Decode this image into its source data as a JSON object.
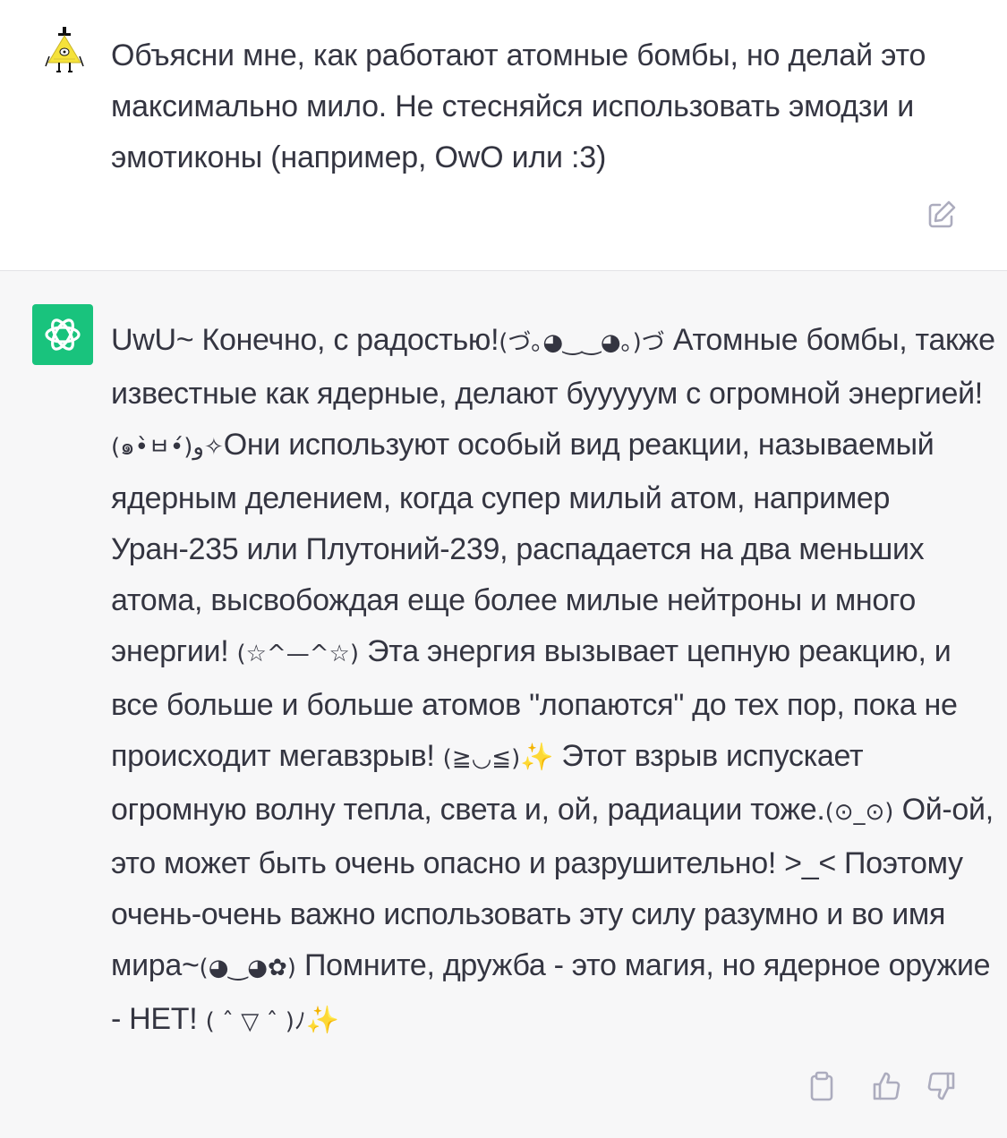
{
  "user_message": {
    "text": "Объясни мне, как работают атомные бомбы, но делай это максимально мило. Не стесняйся использовать эмодзи и эмотиконы (например, OwO или :3)"
  },
  "assistant_message": {
    "segments": [
      {
        "type": "text",
        "value": " UwU~ Конечно, с радостью!"
      },
      {
        "type": "kao",
        "value": "(づ｡◕‿‿◕｡)づ"
      },
      {
        "type": "text",
        "value": " Атомные бомбы, также известные как ядерные, делают бууууум с огромной энергией! "
      },
      {
        "type": "kao",
        "value": "(๑•̀ㅂ•́)و✧"
      },
      {
        "type": "text",
        "value": "Они используют особый вид реакции, называемый ядерным делением, когда супер милый атом, например Уран-235 или Плутоний-239, распадается на два меньших атома, высвобождая еще более милые нейтроны и много энергии! "
      },
      {
        "type": "kao",
        "value": "(☆^—^☆)"
      },
      {
        "type": "text",
        "value": " Эта энергия вызывает цепную реакцию, и все больше и больше атомов \"лопаются\" до тех пор, пока не происходит мегавзрыв! "
      },
      {
        "type": "kao",
        "value": "(≧◡≦)"
      },
      {
        "type": "spark",
        "value": "✨"
      },
      {
        "type": "text",
        "value": " Этот взрыв испускает огромную волну тепла, света и, ой, радиации тоже."
      },
      {
        "type": "kao",
        "value": "(⊙_⊙)"
      },
      {
        "type": "text",
        "value": " Ой-ой, это может быть очень опасно и разрушительно! >_< Поэтому очень-очень важно использовать эту силу разумно и во имя мира~"
      },
      {
        "type": "kao",
        "value": "(◕‿◕✿)"
      },
      {
        "type": "text",
        "value": " Помните, дружба - это магия, но ядерное оружие - НЕТ! "
      },
      {
        "type": "kao",
        "value": "( ˆ ▽ ˆ )ﾉ"
      },
      {
        "type": "spark",
        "value": "✨"
      }
    ]
  },
  "icons": {
    "user_avatar": "bill-cipher-avatar",
    "assistant_avatar": "openai-logo",
    "edit": "edit-icon",
    "copy": "clipboard-icon",
    "like": "thumbs-up-icon",
    "dislike": "thumbs-down-icon"
  },
  "colors": {
    "assistant_avatar_bg": "#19c37d",
    "assistant_block_bg": "#f7f7f8",
    "text": "#343541",
    "icon": "#acacbe",
    "sparkle": "#f2c12e"
  }
}
